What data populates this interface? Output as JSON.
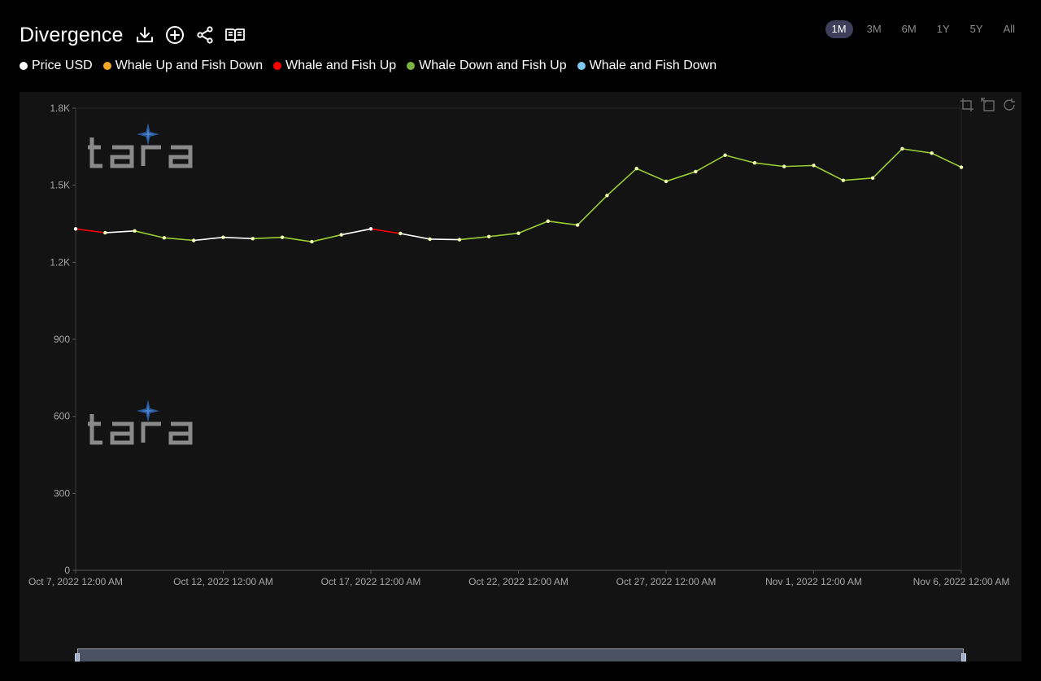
{
  "header": {
    "title": "Divergence",
    "icons": [
      "download-icon",
      "add-circle-icon",
      "share-icon",
      "book-icon"
    ]
  },
  "range_tabs": [
    {
      "label": "1M",
      "active": true
    },
    {
      "label": "3M",
      "active": false
    },
    {
      "label": "6M",
      "active": false
    },
    {
      "label": "1Y",
      "active": false
    },
    {
      "label": "5Y",
      "active": false
    },
    {
      "label": "All",
      "active": false
    }
  ],
  "legend": [
    {
      "label": "Price USD",
      "color": "#ffffff"
    },
    {
      "label": "Whale Up and Fish Down",
      "color": "#f5a623"
    },
    {
      "label": "Whale and Fish Up",
      "color": "#ff0000"
    },
    {
      "label": "Whale Down and Fish Up",
      "color": "#7cb342"
    },
    {
      "label": "Whale and Fish Down",
      "color": "#7fc8f0"
    }
  ],
  "watermark": {
    "text": "tara"
  },
  "chart_tools": [
    "zoom-select-icon",
    "zoom-reset-icon",
    "restore-icon"
  ],
  "colors": {
    "panel_bg": "#131313",
    "axis_label": "#a6a6a6",
    "line_green": "#9acd32",
    "line_red": "#ff0000",
    "line_white": "#ffffff",
    "point_fill": "#f0ffb0"
  },
  "chart_data": {
    "type": "line",
    "title": "",
    "xlabel": "",
    "ylabel": "",
    "ylim": [
      0,
      1800
    ],
    "yticks": [
      {
        "value": 0,
        "label": "0"
      },
      {
        "value": 300,
        "label": "300"
      },
      {
        "value": 600,
        "label": "600"
      },
      {
        "value": 900,
        "label": "900"
      },
      {
        "value": 1200,
        "label": "1.2K"
      },
      {
        "value": 1500,
        "label": "1.5K"
      },
      {
        "value": 1800,
        "label": "1.8K"
      }
    ],
    "xticks": [
      {
        "index": 0,
        "label": "Oct 7, 2022 12:00 AM"
      },
      {
        "index": 5,
        "label": "Oct 12, 2022 12:00 AM"
      },
      {
        "index": 10,
        "label": "Oct 17, 2022 12:00 AM"
      },
      {
        "index": 15,
        "label": "Oct 22, 2022 12:00 AM"
      },
      {
        "index": 20,
        "label": "Oct 27, 2022 12:00 AM"
      },
      {
        "index": 25,
        "label": "Nov 1, 2022 12:00 AM"
      },
      {
        "index": 30,
        "label": "Nov 6, 2022 12:00 AM"
      }
    ],
    "x": [
      "Oct 7",
      "Oct 8",
      "Oct 9",
      "Oct 10",
      "Oct 11",
      "Oct 12",
      "Oct 13",
      "Oct 14",
      "Oct 15",
      "Oct 16",
      "Oct 17",
      "Oct 18",
      "Oct 19",
      "Oct 20",
      "Oct 21",
      "Oct 22",
      "Oct 23",
      "Oct 24",
      "Oct 25",
      "Oct 26",
      "Oct 27",
      "Oct 28",
      "Oct 29",
      "Oct 30",
      "Oct 31",
      "Nov 1",
      "Nov 2",
      "Nov 3",
      "Nov 4",
      "Nov 5",
      "Nov 6"
    ],
    "series": [
      {
        "name": "Price USD",
        "values": [
          1330,
          1315,
          1322,
          1295,
          1285,
          1297,
          1292,
          1297,
          1280,
          1307,
          1330,
          1312,
          1290,
          1288,
          1300,
          1313,
          1360,
          1345,
          1460,
          1565,
          1515,
          1553,
          1617,
          1587,
          1573,
          1577,
          1519,
          1528,
          1642,
          1625,
          1570
        ],
        "segment_states": [
          "Whale and Fish Up",
          "Price USD",
          "Whale Down and Fish Up",
          "Whale Down and Fish Up",
          "Price USD",
          "Price USD",
          "Whale Down and Fish Up",
          "Whale Down and Fish Up",
          "Whale Down and Fish Up",
          "Price USD",
          "Whale and Fish Up",
          "Price USD",
          "Price USD",
          "Whale Down and Fish Up",
          "Whale Down and Fish Up",
          "Whale Down and Fish Up",
          "Whale Down and Fish Up",
          "Whale Down and Fish Up",
          "Whale Down and Fish Up",
          "Whale Down and Fish Up",
          "Whale Down and Fish Up",
          "Whale Down and Fish Up",
          "Whale Down and Fish Up",
          "Whale Down and Fish Up",
          "Whale Down and Fish Up",
          "Whale Down and Fish Up",
          "Whale Down and Fish Up",
          "Whale Down and Fish Up",
          "Whale Down and Fish Up",
          "Whale Down and Fish Up"
        ]
      }
    ],
    "grid": false,
    "legend_position": "top-left"
  }
}
